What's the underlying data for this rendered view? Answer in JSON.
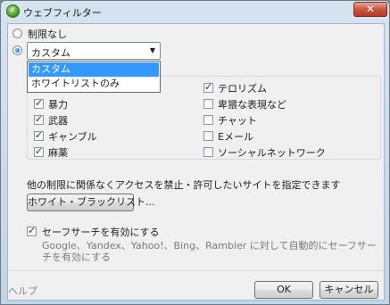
{
  "window": {
    "title": "ウェブフィルター",
    "close_glyph": "✕"
  },
  "mode": {
    "no_limit_label": "制限なし",
    "select_value": "カスタム",
    "dropdown_options": [
      {
        "label": "カスタム",
        "selected": true
      },
      {
        "label": "ホワイトリストのみ",
        "selected": false
      }
    ]
  },
  "categories": [
    {
      "label": "",
      "checked": true
    },
    {
      "label": "暴力",
      "checked": true
    },
    {
      "label": "武器",
      "checked": true
    },
    {
      "label": "ギャンブル",
      "checked": true
    },
    {
      "label": "麻薬",
      "checked": true
    },
    {
      "label": "テロリズム",
      "checked": true
    },
    {
      "label": "卑猥な表現など",
      "checked": false
    },
    {
      "label": "チャット",
      "checked": false
    },
    {
      "label": "Eメール",
      "checked": false
    },
    {
      "label": "ソーシャルネットワーク",
      "checked": false
    }
  ],
  "whitelist": {
    "description": "他の制限に関係なくアクセスを禁止・許可したいサイトを指定できます",
    "button_label": "ホワイト・ブラックリスト..."
  },
  "safesearch": {
    "label": "セーフサーチを有効にする",
    "checked": true,
    "description": "Google、Yandex、Yahoo!、Bing、Rambler に対して自動的にセーフサーチを有効にする"
  },
  "footer": {
    "help_label": "ヘルプ",
    "ok_label": "OK",
    "cancel_label": "キャンセル"
  }
}
